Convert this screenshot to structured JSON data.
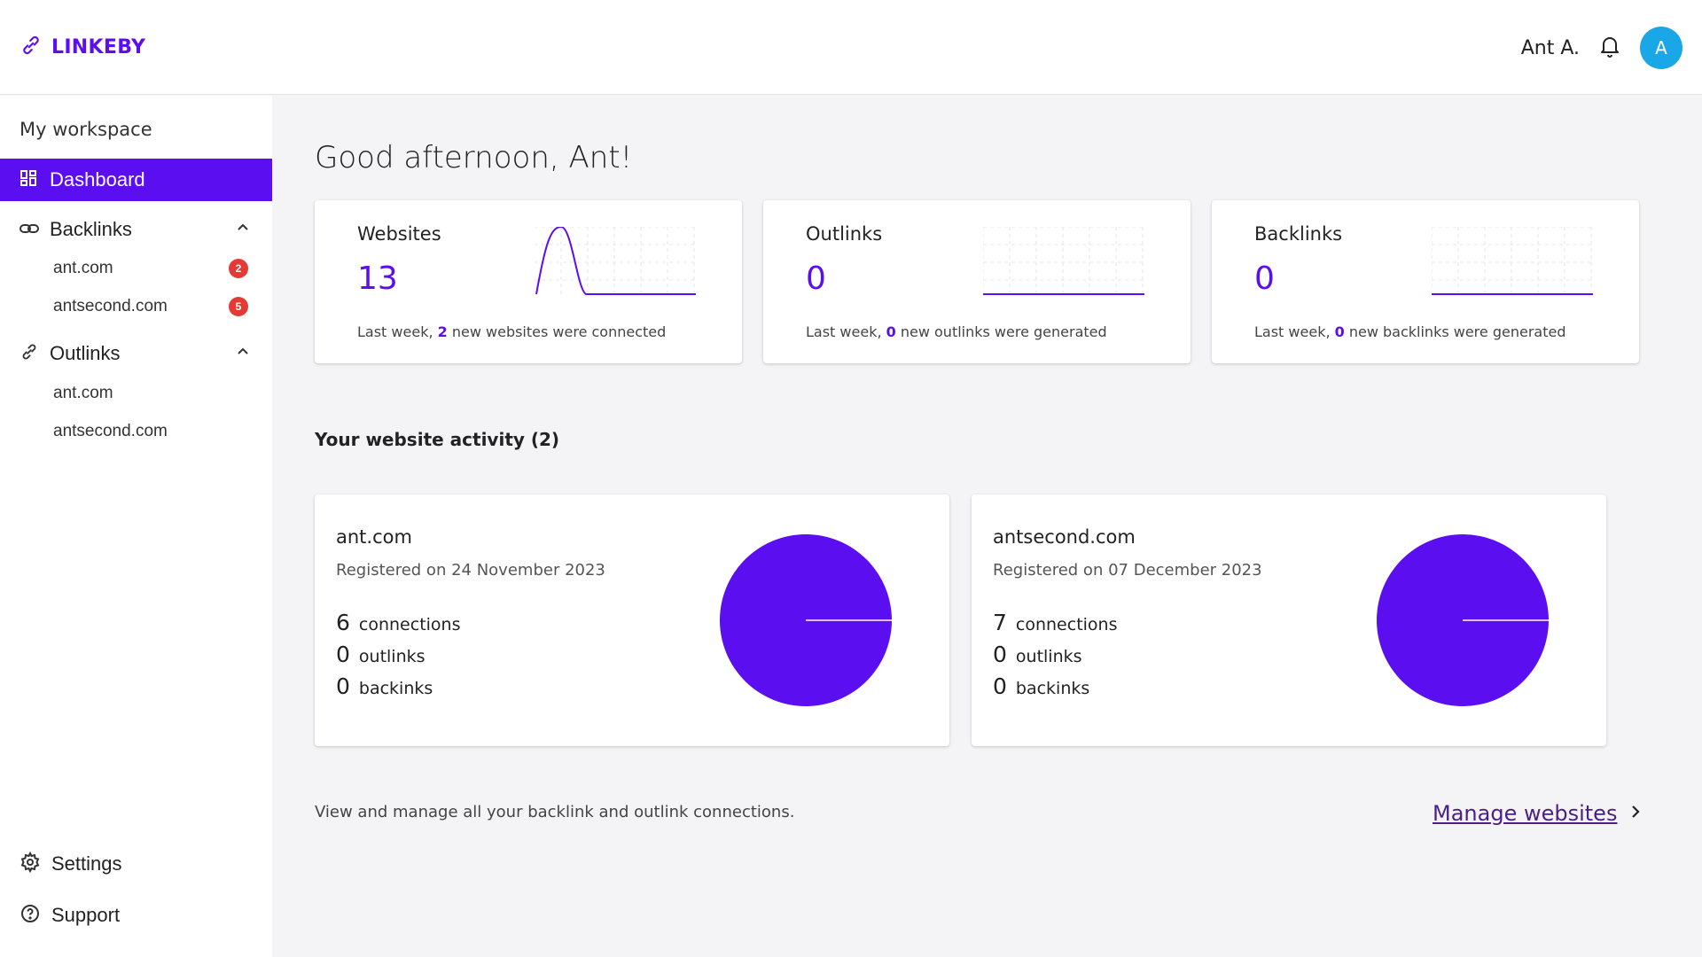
{
  "app": {
    "name": "LINKEBY"
  },
  "header": {
    "user_name": "Ant A.",
    "avatar_initial": "A"
  },
  "sidebar": {
    "workspace_title": "My workspace",
    "dashboard_label": "Dashboard",
    "backlinks": {
      "label": "Backlinks",
      "items": [
        {
          "label": "ant.com",
          "badge": "2"
        },
        {
          "label": "antsecond.com",
          "badge": "5"
        }
      ]
    },
    "outlinks": {
      "label": "Outlinks",
      "items": [
        {
          "label": "ant.com"
        },
        {
          "label": "antsecond.com"
        }
      ]
    },
    "settings_label": "Settings",
    "support_label": "Support"
  },
  "main": {
    "greeting": "Good afternoon, Ant!",
    "stats": [
      {
        "title": "Websites",
        "value": "13",
        "desc_prefix": "Last week, ",
        "desc_count": "2",
        "desc_suffix": " new websites were connected"
      },
      {
        "title": "Outlinks",
        "value": "0",
        "desc_prefix": "Last week, ",
        "desc_count": "0",
        "desc_suffix": " new outlinks were generated"
      },
      {
        "title": "Backlinks",
        "value": "0",
        "desc_prefix": "Last week, ",
        "desc_count": "0",
        "desc_suffix": " new backlinks were generated"
      }
    ],
    "activity_title": "Your website activity (2)",
    "sites": [
      {
        "name": "ant.com",
        "registered": "Registered on 24 November 2023",
        "connections": "6",
        "connections_label": "connections",
        "outlinks": "0",
        "outlinks_label": "outlinks",
        "backlinks": "0",
        "backlinks_label": "backinks"
      },
      {
        "name": "antsecond.com",
        "registered": "Registered on 07 December 2023",
        "connections": "7",
        "connections_label": "connections",
        "outlinks": "0",
        "outlinks_label": "outlinks",
        "backlinks": "0",
        "backlinks_label": "backinks"
      }
    ],
    "footer_text": "View and manage all your backlink and outlink connections.",
    "manage_link": "Manage websites"
  },
  "colors": {
    "accent": "#5b0ef0",
    "badge": "#e53935",
    "avatar": "#1aa7e8",
    "link": "#4a1f86"
  }
}
